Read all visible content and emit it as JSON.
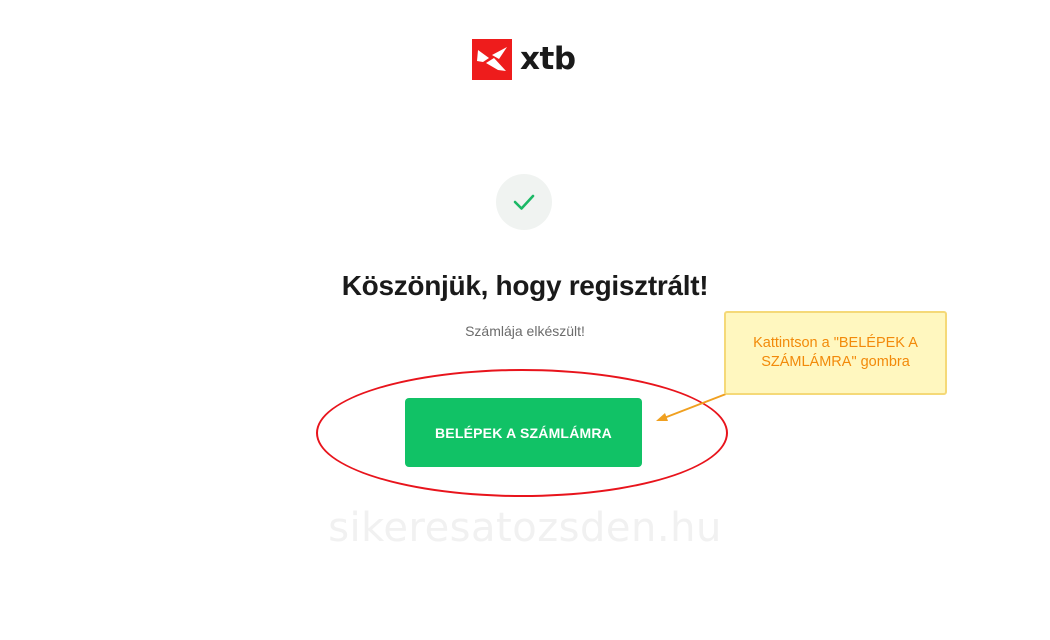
{
  "logo": {
    "text": "xtb",
    "brand_color": "#ee1c1c",
    "icon": "xtb-x-logo-icon"
  },
  "status": {
    "icon": "checkmark-icon",
    "icon_color": "#1bb865"
  },
  "heading": {
    "title": "Köszönjük, hogy regisztrált!",
    "subtitle": "Számlája elkészült!"
  },
  "actions": {
    "login_label": "BELÉPEK A SZÁMLÁMRA",
    "button_color": "#11c266"
  },
  "annotation": {
    "callout_text": "Kattintson a \"BELÉPEK A SZÁMLÁMRA\" gombra",
    "highlight_color": "#e8141c",
    "callout_text_color": "#f28a0a"
  },
  "watermark": {
    "text": "sikeresatozsden.hu"
  }
}
